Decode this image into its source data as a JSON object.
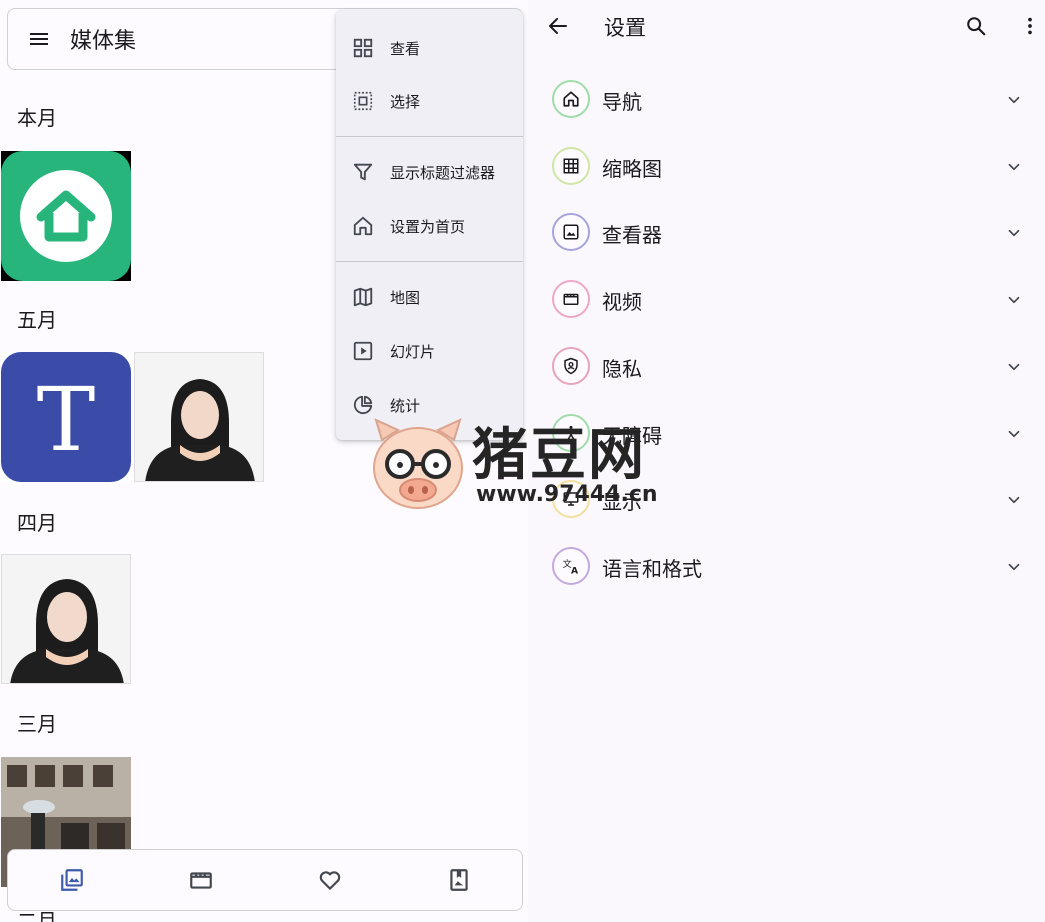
{
  "gallery": {
    "title": "媒体集",
    "sections": [
      {
        "label": "本月"
      },
      {
        "label": "五月"
      },
      {
        "label": "四月"
      },
      {
        "label": "三月"
      },
      {
        "label": "二月"
      }
    ]
  },
  "overflow_menu": {
    "items": [
      {
        "label": "查看",
        "icon": "grid-view-icon"
      },
      {
        "label": "选择",
        "icon": "select-icon"
      },
      {
        "label": "显示标题过滤器",
        "icon": "filter-icon"
      },
      {
        "label": "设置为首页",
        "icon": "home-icon"
      },
      {
        "label": "地图",
        "icon": "map-icon"
      },
      {
        "label": "幻灯片",
        "icon": "slideshow-icon"
      },
      {
        "label": "统计",
        "icon": "stats-icon"
      }
    ]
  },
  "bottom_nav": {
    "items": [
      {
        "icon": "photo-library-icon",
        "active": true
      },
      {
        "icon": "movie-icon",
        "active": false
      },
      {
        "icon": "heart-icon",
        "active": false
      },
      {
        "icon": "album-icon",
        "active": false
      }
    ]
  },
  "settings": {
    "title": "设置",
    "items": [
      {
        "label": "导航",
        "icon": "home-icon",
        "ring_color": "#9fdcaa"
      },
      {
        "label": "缩略图",
        "icon": "grid-icon",
        "ring_color": "#cfe6a4"
      },
      {
        "label": "查看器",
        "icon": "image-icon",
        "ring_color": "#a7a4db"
      },
      {
        "label": "视频",
        "icon": "movie-icon",
        "ring_color": "#f0a7c6"
      },
      {
        "label": "隐私",
        "icon": "shield-icon",
        "ring_color": "#e8a5b9"
      },
      {
        "label": "无障碍",
        "icon": "accessibility-icon",
        "ring_color": "#9fdcaa"
      },
      {
        "label": "显示",
        "icon": "display-icon",
        "ring_color": "#f3e09e"
      },
      {
        "label": "语言和格式",
        "icon": "translate-icon",
        "ring_color": "#c3a9e0"
      }
    ]
  },
  "watermark": {
    "title": "猪豆网",
    "url": "www.97444.cn"
  },
  "colors": {
    "accent": "#3d5ba9",
    "background": "#fdfbff",
    "menu_surface": "#f0eff5"
  }
}
